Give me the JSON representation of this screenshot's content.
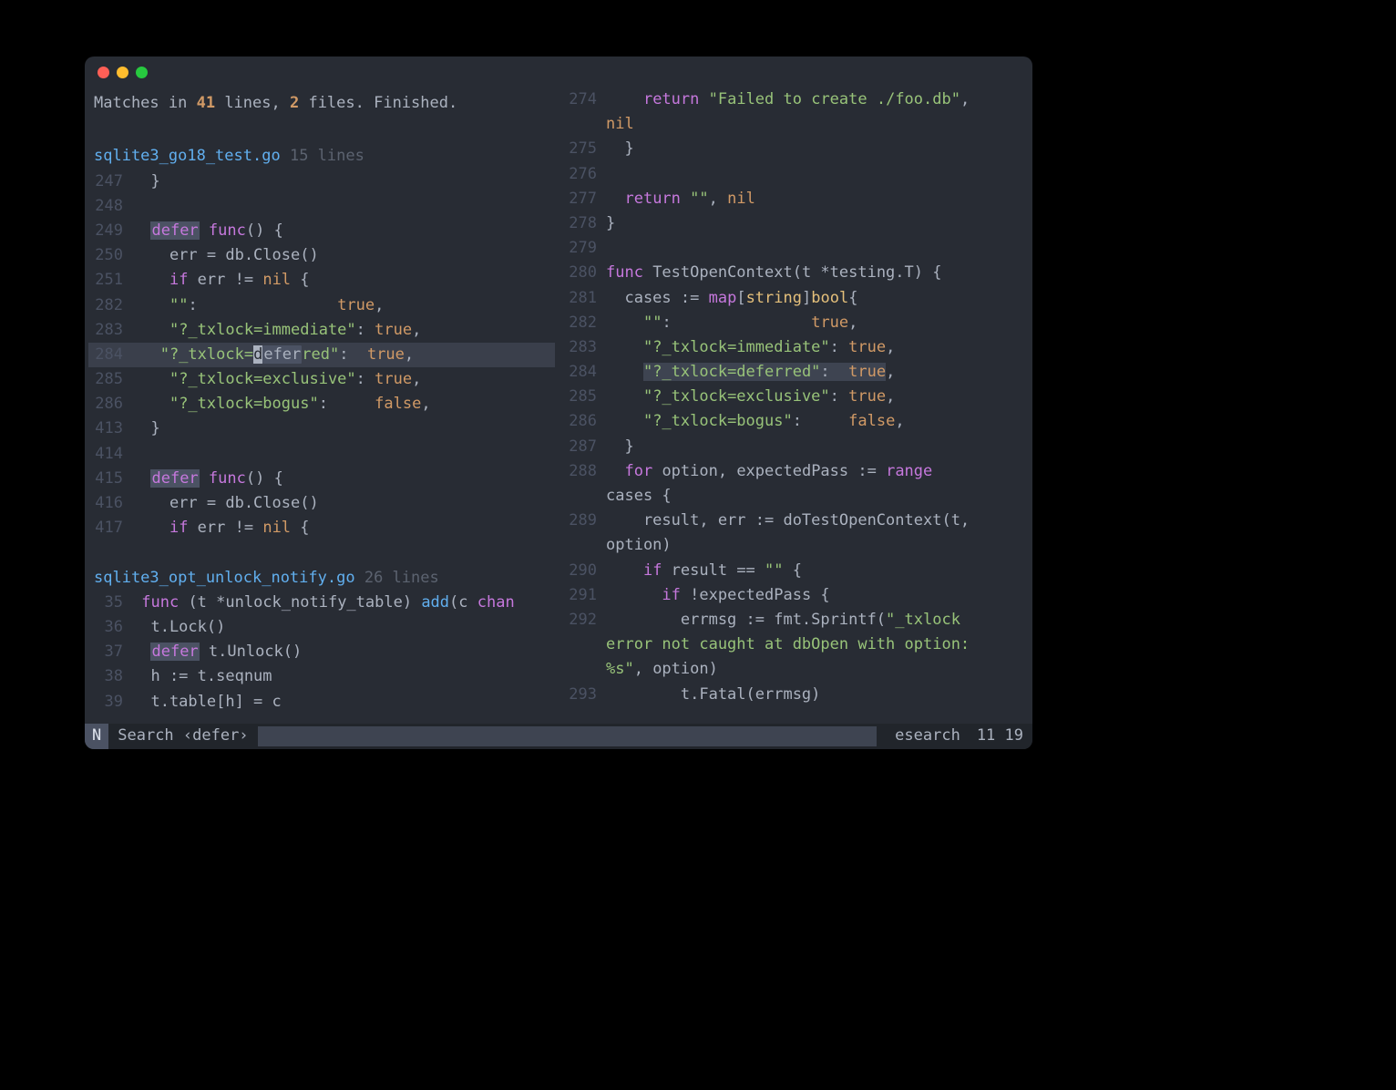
{
  "summary": {
    "prefix": "Matches in ",
    "lines": "41",
    "mid": " lines, ",
    "files": "2",
    "suffix": " files. Finished."
  },
  "left": {
    "file1": {
      "name": "sqlite3_go18_test.go",
      "count": "15 lines"
    },
    "file2": {
      "name": "sqlite3_opt_unlock_notify.go",
      "count": "26 lines"
    },
    "lines": {
      "l247": {
        "num": "247",
        "brace": "}"
      },
      "l248": {
        "num": "248"
      },
      "l249": {
        "num": "249",
        "defer": "defer",
        "func": "func",
        "rest": "() {"
      },
      "l250": {
        "num": "250",
        "text": "    err = db.Close()"
      },
      "l251": {
        "num": "251",
        "if": "if",
        "rest": " err != ",
        "nil": "nil",
        "brace": " {"
      },
      "l282": {
        "num": "282",
        "str": "\"\"",
        "colon": ":               ",
        "bool": "true",
        "comma": ","
      },
      "l283": {
        "num": "283",
        "str": "\"?_txlock=immediate\"",
        "colon": ": ",
        "bool": "true",
        "comma": ","
      },
      "l284": {
        "num": "284",
        "pre": "\"?_txlock=",
        "d": "d",
        "efer": "efer",
        "red": "red\"",
        "colon": ":  ",
        "bool": "true",
        "comma": ","
      },
      "l285": {
        "num": "285",
        "str": "\"?_txlock=exclusive\"",
        "colon": ": ",
        "bool": "true",
        "comma": ","
      },
      "l286": {
        "num": "286",
        "str": "\"?_txlock=bogus\"",
        "colon": ":     ",
        "bool": "false",
        "comma": ","
      },
      "l413": {
        "num": "413",
        "brace": "}"
      },
      "l414": {
        "num": "414"
      },
      "l415": {
        "num": "415",
        "defer": "defer",
        "func": "func",
        "rest": "() {"
      },
      "l416": {
        "num": "416",
        "text": "    err = db.Close()"
      },
      "l417": {
        "num": "417",
        "if": "if",
        "rest": " err != ",
        "nil": "nil",
        "brace": " {"
      },
      "l35": {
        "num": "35",
        "func": "func",
        "recv": " (t *unlock_notify_table) ",
        "add": "add",
        "paren": "(c ",
        "chan": "chan"
      },
      "l36": {
        "num": "36",
        "text": "  t.Lock()"
      },
      "l37": {
        "num": "37",
        "sp": "  ",
        "defer": "defer",
        "rest": " t.Unlock()"
      },
      "l38": {
        "num": "38",
        "text": "  h := t.seqnum"
      },
      "l39": {
        "num": "39",
        "text": "  t.table[h] = c"
      }
    }
  },
  "right": {
    "lines": {
      "l274": {
        "num": "274",
        "return": "return",
        "str": "\"Failed to create ./foo.db\"",
        "comma": ","
      },
      "l274b": {
        "nil": "nil"
      },
      "l275": {
        "num": "275",
        "brace": "  }"
      },
      "l276": {
        "num": "276"
      },
      "l277": {
        "num": "277",
        "return": "return",
        "sp": " ",
        "str": "\"\"",
        "comma": ", ",
        "nil": "nil"
      },
      "l278": {
        "num": "278",
        "brace": "}"
      },
      "l279": {
        "num": "279"
      },
      "l280": {
        "num": "280",
        "func": "func",
        "name": " TestOpenContext(t *testing.T) {"
      },
      "l281": {
        "num": "281",
        "text": "  cases := ",
        "map": "map",
        "br": "[",
        "string": "string",
        "rb": "]",
        "bool": "bool",
        "brace": "{"
      },
      "l282": {
        "num": "282",
        "str": "\"\"",
        "colon": ":               ",
        "bool": "true",
        "comma": ","
      },
      "l283": {
        "num": "283",
        "str": "\"?_txlock=immediate\"",
        "colon": ": ",
        "bool": "true",
        "comma": ","
      },
      "l284": {
        "num": "284",
        "str": "\"?_txlock=deferred\"",
        "colon": ":  ",
        "bool": "true",
        "comma": ","
      },
      "l285": {
        "num": "285",
        "str": "\"?_txlock=exclusive\"",
        "colon": ": ",
        "bool": "true",
        "comma": ","
      },
      "l286": {
        "num": "286",
        "str": "\"?_txlock=bogus\"",
        "colon": ":     ",
        "bool": "false",
        "comma": ","
      },
      "l287": {
        "num": "287",
        "brace": "  }"
      },
      "l288": {
        "num": "288",
        "for": "for",
        "rest": " option, expectedPass := ",
        "range": "range"
      },
      "l288b": {
        "text": "cases {"
      },
      "l289": {
        "num": "289",
        "text": "    result, err := doTestOpenContext(t,"
      },
      "l289b": {
        "text": "option)"
      },
      "l290": {
        "num": "290",
        "if": "if",
        "rest": " result == ",
        "str": "\"\"",
        "brace": " {"
      },
      "l291": {
        "num": "291",
        "if": "if",
        "rest": " !expectedPass {"
      },
      "l292": {
        "num": "292",
        "text": "        errmsg := fmt.Sprintf(",
        "str": "\"_txlock"
      },
      "l292b": {
        "str": "error not caught at dbOpen with option:"
      },
      "l292c": {
        "str": "%s\"",
        "rest": ", option)"
      },
      "l293": {
        "num": "293",
        "text": "        t.Fatal(errmsg)"
      }
    }
  },
  "status": {
    "mode": "N",
    "label": "Search ‹defer›",
    "right_mode": "esearch",
    "pos": "11 19"
  }
}
